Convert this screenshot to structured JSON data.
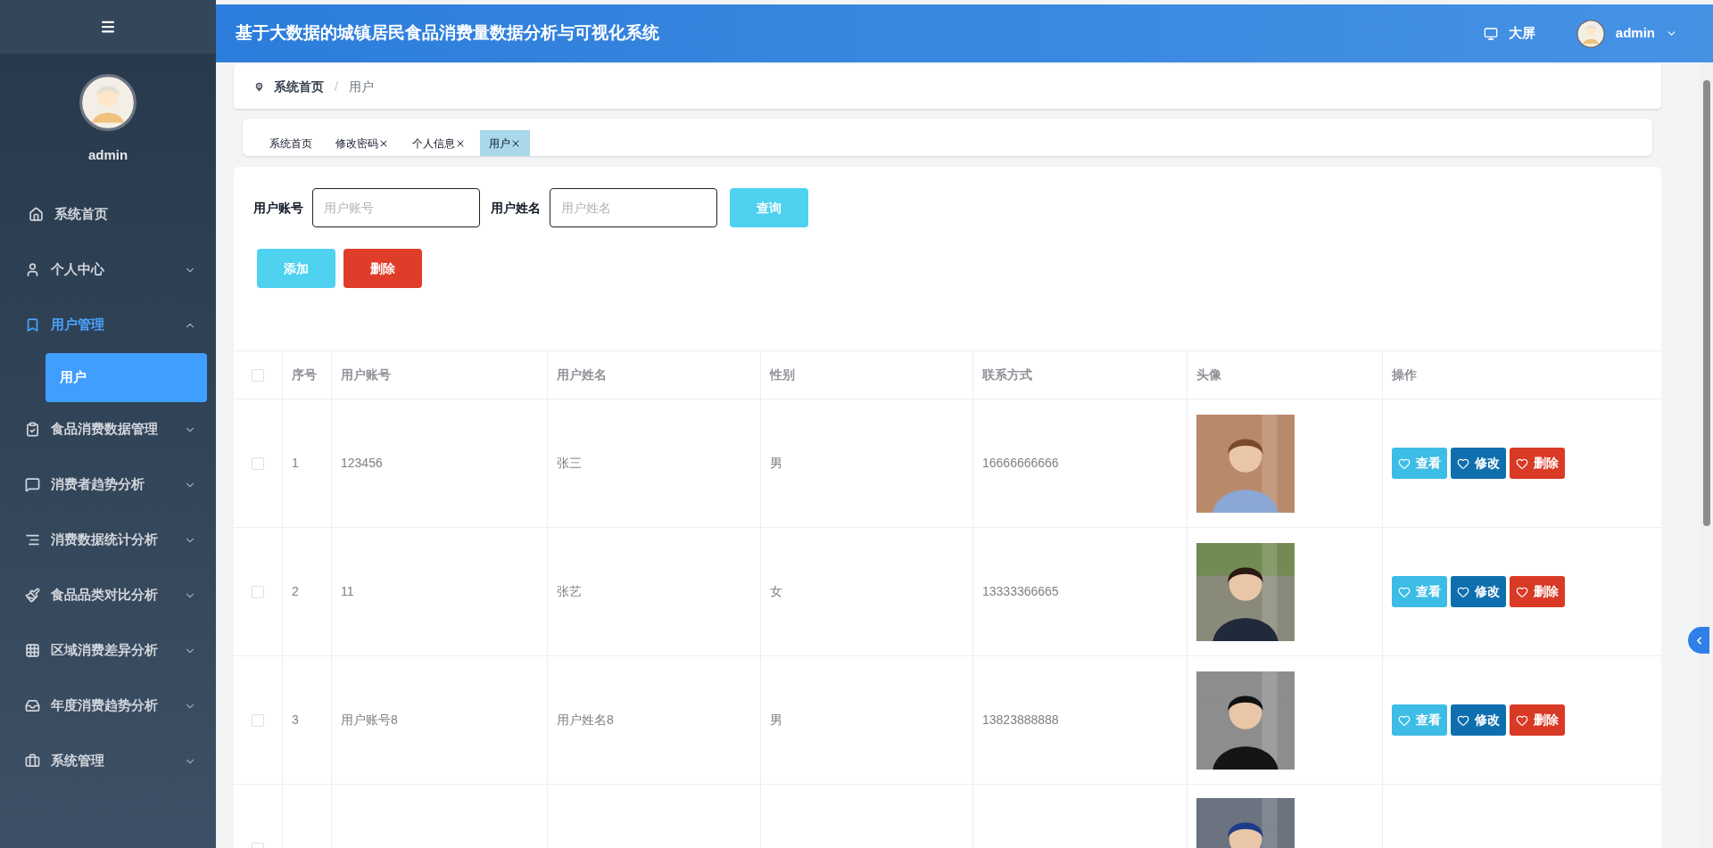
{
  "header": {
    "title": "基于大数据的城镇居民食品消费量数据分析与可视化系统",
    "screen_link": "大屏",
    "user": "admin"
  },
  "sidebar": {
    "username": "admin",
    "items": [
      {
        "kind": "link",
        "label": "系统首页",
        "selected": false
      },
      {
        "kind": "group",
        "label": "个人中心",
        "selected": false,
        "expanded": false
      },
      {
        "kind": "group",
        "label": "用户管理",
        "selected": true,
        "expanded": true,
        "children": [
          {
            "label": "用户",
            "selected": true
          }
        ]
      },
      {
        "kind": "group",
        "label": "食品消费数据管理",
        "selected": false,
        "expanded": false
      },
      {
        "kind": "group",
        "label": "消费者趋势分析",
        "selected": false,
        "expanded": false
      },
      {
        "kind": "group",
        "label": "消费数据统计分析",
        "selected": false,
        "expanded": false
      },
      {
        "kind": "group",
        "label": "食品品类对比分析",
        "selected": false,
        "expanded": false
      },
      {
        "kind": "group",
        "label": "区域消费差异分析",
        "selected": false,
        "expanded": false
      },
      {
        "kind": "group",
        "label": "年度消费趋势分析",
        "selected": false,
        "expanded": false
      },
      {
        "kind": "group",
        "label": "系统管理",
        "selected": false,
        "expanded": false
      }
    ]
  },
  "breadcrumb": {
    "separator": "/",
    "items": [
      "系统首页",
      "用户"
    ]
  },
  "tabs": [
    {
      "label": "系统首页",
      "closable": false,
      "selected": false
    },
    {
      "label": "修改密码",
      "closable": true,
      "selected": false
    },
    {
      "label": "个人信息",
      "closable": true,
      "selected": false
    },
    {
      "label": "用户",
      "closable": true,
      "selected": true
    }
  ],
  "search": {
    "fields": [
      {
        "label": "用户账号",
        "placeholder": "用户账号"
      },
      {
        "label": "用户姓名",
        "placeholder": "用户姓名"
      }
    ],
    "button": "查询"
  },
  "actions": [
    {
      "kind": "add",
      "label": "添加"
    },
    {
      "kind": "delete",
      "label": "删除"
    }
  ],
  "table": {
    "all_selected": false,
    "columns": [
      "序号",
      "用户账号",
      "用户姓名",
      "性别",
      "联系方式",
      "头像",
      "操作"
    ],
    "rows": [
      {
        "selected": false,
        "cells": [
          "1",
          "123456",
          "张三",
          "男",
          "16666666666"
        ],
        "picture": {
          "kind": "picture"
        },
        "actions": [
          {
            "kind": "view",
            "label": "查看"
          },
          {
            "kind": "edit",
            "label": "修改"
          },
          {
            "kind": "delete",
            "label": "删除"
          }
        ]
      },
      {
        "selected": false,
        "cells": [
          "2",
          "11",
          "张艺",
          "女",
          "13333366665"
        ],
        "picture": {
          "kind": "picture"
        },
        "actions": [
          {
            "kind": "view",
            "label": "查看"
          },
          {
            "kind": "edit",
            "label": "修改"
          },
          {
            "kind": "delete",
            "label": "删除"
          }
        ]
      },
      {
        "selected": false,
        "cells": [
          "3",
          "用户账号8",
          "用户姓名8",
          "男",
          "13823888888"
        ],
        "picture": {
          "kind": "picture"
        },
        "actions": [
          {
            "kind": "view",
            "label": "查看"
          },
          {
            "kind": "edit",
            "label": "修改"
          },
          {
            "kind": "delete",
            "label": "删除"
          }
        ]
      },
      {
        "selected": false,
        "cells": [],
        "picture": {
          "kind": "picture"
        },
        "actions": []
      }
    ]
  }
}
